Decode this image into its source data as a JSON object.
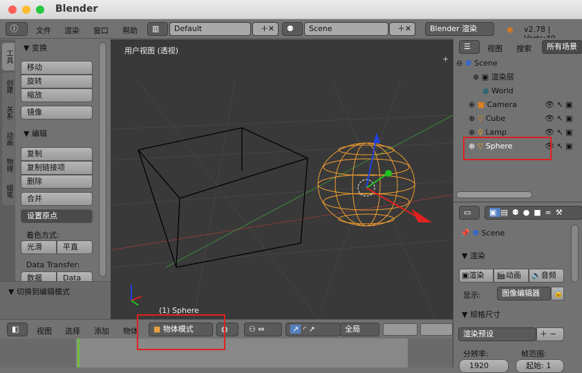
{
  "window": {
    "title": "Blender"
  },
  "topbar": {
    "menus": [
      "文件",
      "渲染",
      "窗口",
      "帮助"
    ],
    "layout": "Default",
    "scene": "Scene",
    "engine": "Blender 渲染",
    "version": "v2.78 | Verts:49"
  },
  "tool_tabs": [
    "工具",
    "创建",
    "关系",
    "动画",
    "物理",
    "蜡笔"
  ],
  "tools": {
    "transform_header": "变换",
    "move": "移动",
    "rotate": "旋转",
    "scale": "缩放",
    "mirror": "镜像",
    "edit_header": "编辑",
    "duplicate": "复制",
    "duplicate_linked": "复制链接项",
    "delete": "删除",
    "join": "合并",
    "set_origin": "设置原点",
    "shading_label": "着色方式:",
    "smooth": "光滑",
    "flat": "平直",
    "data_transfer_label": "Data Transfer:",
    "data": "数据",
    "data_layers": "Data La",
    "operator_header": "切换到编辑模式"
  },
  "viewport": {
    "view_label": "用户视图 (透视)",
    "object_label": "(1) Sphere"
  },
  "view_header": {
    "menus": [
      "视图",
      "选择",
      "添加",
      "物体"
    ],
    "mode": "物体模式",
    "orientation": "全局"
  },
  "outliner": {
    "view": "视图",
    "search": "搜索",
    "filter": "所有场景",
    "items": [
      {
        "name": "Scene",
        "icon": "scene-icon"
      },
      {
        "name": "渲染层",
        "icon": "render-layer-icon"
      },
      {
        "name": "World",
        "icon": "world-icon"
      },
      {
        "name": "Camera",
        "icon": "camera-icon"
      },
      {
        "name": "Cube",
        "icon": "mesh-icon"
      },
      {
        "name": "Lamp",
        "icon": "lamp-icon"
      },
      {
        "name": "Sphere",
        "icon": "mesh-icon"
      }
    ]
  },
  "properties": {
    "context": "Scene",
    "render_header": "渲染",
    "render": "渲染",
    "animation": "动画",
    "audio": "音频",
    "display_label": "显示:",
    "display_value": "图像编辑器",
    "dimensions_header": "规格尺寸",
    "render_presets": "渲染预设",
    "resolution_label": "分辨率:",
    "resolution_x": "1920",
    "frame_range_label": "帧范围:",
    "frame_start": "起始: 1"
  },
  "colors": {
    "highlight": "#e0201e",
    "selected": "#f5a030",
    "viewport_bg": "#393939"
  }
}
